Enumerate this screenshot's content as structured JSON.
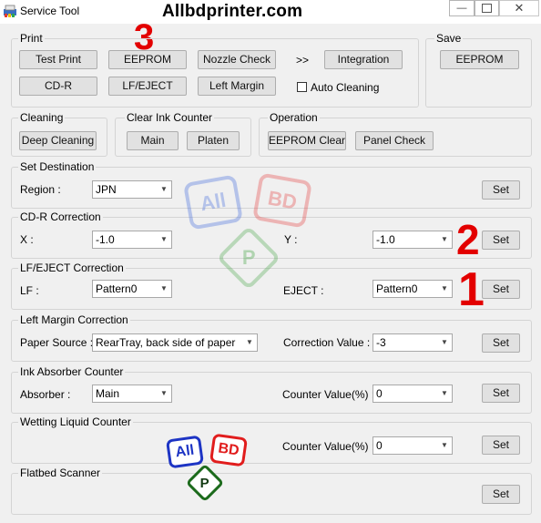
{
  "window": {
    "title": "Service Tool",
    "watermark": "Allbdprinter.com"
  },
  "annotations": {
    "n3": "3",
    "n2": "2",
    "n1": "1"
  },
  "print": {
    "label": "Print",
    "test_print": "Test Print",
    "eeprom": "EEPROM",
    "nozzle_check": "Nozzle Check",
    "arrow": ">>",
    "integration": "Integration",
    "cdr": "CD-R",
    "lf_eject": "LF/EJECT",
    "left_margin": "Left Margin",
    "auto_cleaning": "Auto Cleaning",
    "auto_cleaning_checked": false
  },
  "save": {
    "label": "Save",
    "eeprom": "EEPROM"
  },
  "cleaning": {
    "label": "Cleaning",
    "deep_cleaning": "Deep Cleaning"
  },
  "clear_ink_counter": {
    "label": "Clear Ink Counter",
    "main": "Main",
    "platen": "Platen"
  },
  "operation": {
    "label": "Operation",
    "eeprom_clear": "EEPROM Clear",
    "panel_check": "Panel Check"
  },
  "set_destination": {
    "label": "Set Destination",
    "region_label": "Region :",
    "region_value": "JPN",
    "set": "Set"
  },
  "cdr_correction": {
    "label": "CD-R Correction",
    "x_label": "X :",
    "x_value": "-1.0",
    "y_label": "Y :",
    "y_value": "-1.0",
    "set": "Set"
  },
  "lf_eject_correction": {
    "label": "LF/EJECT Correction",
    "lf_label": "LF :",
    "lf_value": "Pattern0",
    "eject_label": "EJECT :",
    "eject_value": "Pattern0",
    "set": "Set"
  },
  "left_margin_correction": {
    "label": "Left Margin Correction",
    "paper_label": "Paper Source :",
    "paper_value": "RearTray, back side of paper",
    "correction_label": "Correction Value :",
    "correction_value": "-3",
    "set": "Set"
  },
  "ink_absorber": {
    "label": "Ink Absorber Counter",
    "absorber_label": "Absorber :",
    "absorber_value": "Main",
    "counter_label": "Counter Value(%) :",
    "counter_value": "0",
    "set": "Set"
  },
  "wetting_liquid": {
    "label": "Wetting Liquid Counter",
    "counter_label": "Counter Value(%) :",
    "counter_value": "0",
    "set": "Set"
  },
  "flatbed_scanner": {
    "label": "Flatbed Scanner",
    "set": "Set"
  },
  "logo": {
    "all": "All",
    "bd": "BD",
    "p": "P"
  }
}
